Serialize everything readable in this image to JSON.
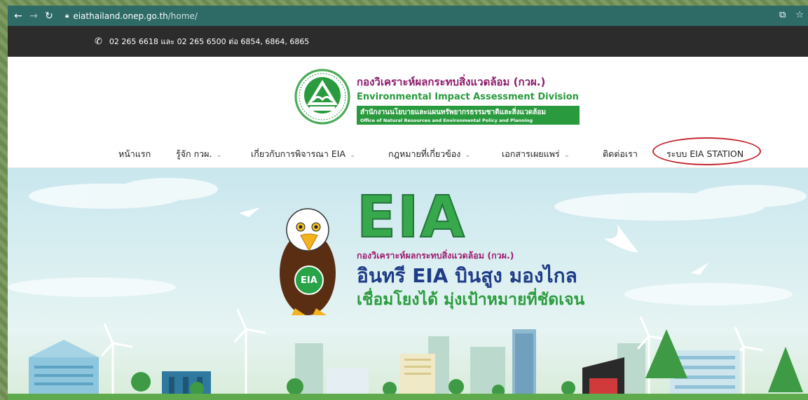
{
  "browser": {
    "url_host": "eiathailand.onep.go.th",
    "url_path": "/home/"
  },
  "topbar": {
    "phone": "02 265 6618 และ 02 265 6500 ต่อ 6854, 6864, 6865"
  },
  "brand": {
    "title_th": "กองวิเคราะห์ผลกระทบสิ่งแวดล้อม (กวผ.)",
    "title_en": "Environmental Impact Assessment Division",
    "office_th": "สำนักงานนโยบายและแผนทรัพยากรธรรมชาติและสิ่งแวดล้อม",
    "office_en": "Office of Natural Resources and Environmental Policy and Planning"
  },
  "nav": {
    "items": [
      {
        "label": "หน้าแรก",
        "has_dropdown": false
      },
      {
        "label": "รู้จัก กวผ.",
        "has_dropdown": true
      },
      {
        "label": "เกี่ยวกับการพิจารณา EIA",
        "has_dropdown": true
      },
      {
        "label": "กฎหมายที่เกี่ยวข้อง",
        "has_dropdown": true
      },
      {
        "label": "เอกสารเผยแพร่",
        "has_dropdown": true
      },
      {
        "label": "ติดต่อเรา",
        "has_dropdown": false
      },
      {
        "label": "ระบบ EIA STATION",
        "has_dropdown": false
      }
    ],
    "chevron": "⌄"
  },
  "hero": {
    "big": "EIA",
    "sub": "กองวิเคราะห์ผลกระทบสิ่งแวดล้อม (กวผ.)",
    "line1": "อินทรี EIA บินสูง มองไกล",
    "line2": "เชื่อมโยงได้ มุ่งเป้าหมายที่ชัดเจน",
    "mascot_badge": "EIA"
  },
  "colors": {
    "address_bar": "#2e6a66",
    "topbar": "#2c2c2c",
    "brand_purple": "#8b1b6b",
    "brand_green": "#2a9a3e",
    "highlight_circle": "#c4262e"
  }
}
